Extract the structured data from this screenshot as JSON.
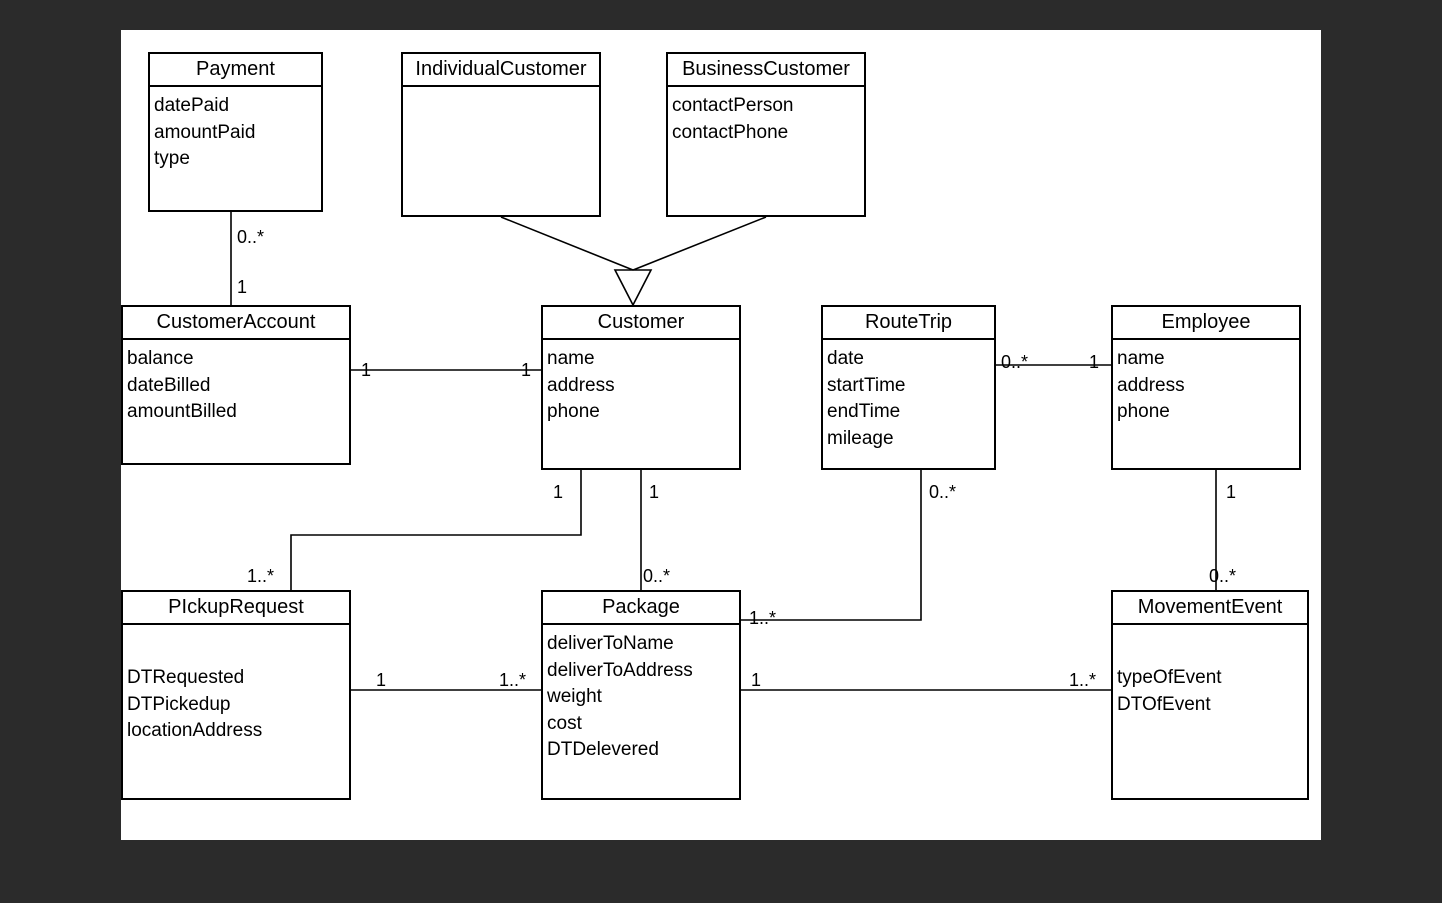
{
  "classes": {
    "Payment": {
      "name": "Payment",
      "attrs": [
        "datePaid",
        "amountPaid",
        "type"
      ]
    },
    "IndividualCustomer": {
      "name": "IndividualCustomer",
      "attrs": []
    },
    "BusinessCustomer": {
      "name": "BusinessCustomer",
      "attrs": [
        "contactPerson",
        "contactPhone"
      ]
    },
    "CustomerAccount": {
      "name": "CustomerAccount",
      "attrs": [
        "balance",
        "dateBilled",
        "amountBilled"
      ]
    },
    "Customer": {
      "name": "Customer",
      "attrs": [
        "name",
        "address",
        "phone"
      ]
    },
    "RouteTrip": {
      "name": "RouteTrip",
      "attrs": [
        "date",
        "startTime",
        "endTime",
        "mileage"
      ]
    },
    "Employee": {
      "name": "Employee",
      "attrs": [
        "name",
        "address",
        "phone"
      ]
    },
    "PickupRequest": {
      "name": "PIckupRequest",
      "attrs": [
        "DTRequested",
        "DTPickedup",
        "locationAddress"
      ]
    },
    "Package": {
      "name": "Package",
      "attrs": [
        "deliverToName",
        "deliverToAddress",
        "weight",
        "cost",
        "DTDelevered"
      ]
    },
    "MovementEvent": {
      "name": "MovementEvent",
      "attrs": [
        "typeOfEvent",
        "DTOfEvent"
      ]
    }
  },
  "multiplicities": {
    "pay_ca_top": "0..*",
    "pay_ca_bot": "1",
    "ca_cust_l": "1",
    "ca_cust_r": "1",
    "rt_emp_l": "0..*",
    "rt_emp_r": "1",
    "cust_pkg_t": "1",
    "cust_pkg_b": "0..*",
    "cust_pr_t": "1",
    "cust_pr_b": "1..*",
    "pr_pkg_l": "1",
    "pr_pkg_r": "1..*",
    "rt_pkg_t": "0..*",
    "rt_pkg_b": "1..*",
    "emp_me_t": "1",
    "emp_me_b": "0..*",
    "pkg_me_l": "1",
    "pkg_me_r": "1..*"
  },
  "diagram_semantics": {
    "type": "UML class diagram",
    "generalizations": [
      {
        "super": "Customer",
        "sub": "IndividualCustomer"
      },
      {
        "super": "Customer",
        "sub": "BusinessCustomer"
      }
    ],
    "associations": [
      {
        "a": "Payment",
        "amult": "0..*",
        "b": "CustomerAccount",
        "bmult": "1"
      },
      {
        "a": "CustomerAccount",
        "amult": "1",
        "b": "Customer",
        "bmult": "1"
      },
      {
        "a": "RouteTrip",
        "amult": "0..*",
        "b": "Employee",
        "bmult": "1"
      },
      {
        "a": "Customer",
        "amult": "1",
        "b": "Package",
        "bmult": "0..*"
      },
      {
        "a": "Customer",
        "amult": "1",
        "b": "PickupRequest",
        "bmult": "1..*"
      },
      {
        "a": "PickupRequest",
        "amult": "1",
        "b": "Package",
        "bmult": "1..*"
      },
      {
        "a": "RouteTrip",
        "amult": "0..*",
        "b": "Package",
        "bmult": "1..*"
      },
      {
        "a": "Employee",
        "amult": "1",
        "b": "MovementEvent",
        "bmult": "0..*"
      },
      {
        "a": "Package",
        "amult": "1",
        "b": "MovementEvent",
        "bmult": "1..*"
      }
    ]
  }
}
